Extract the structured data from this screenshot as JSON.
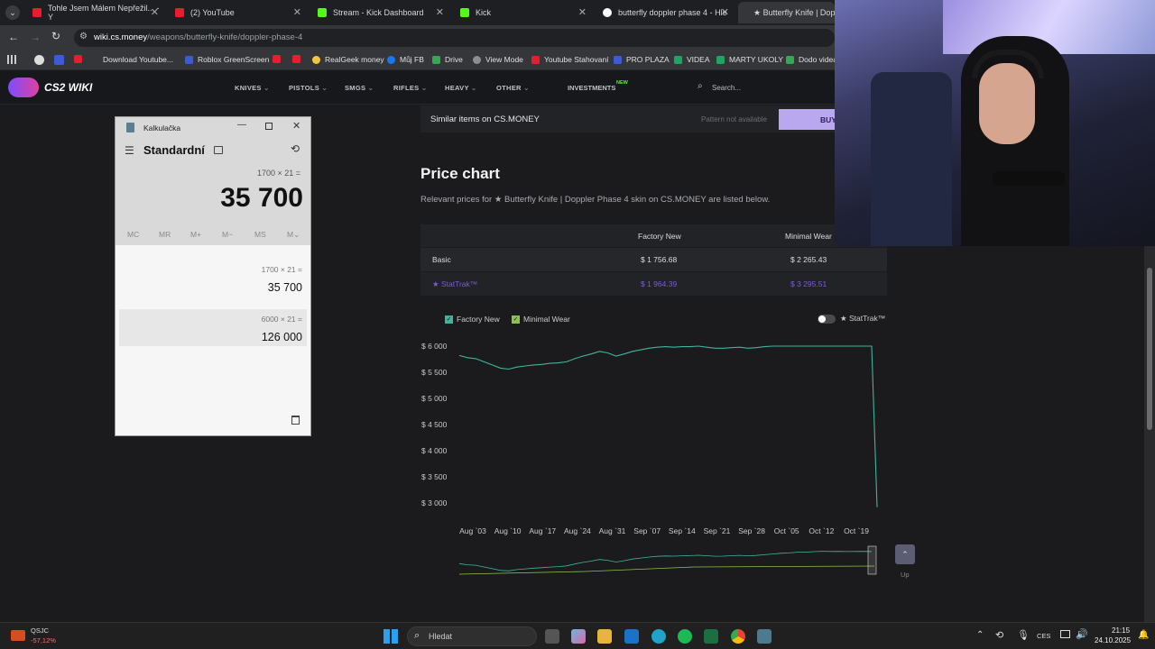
{
  "browser": {
    "tabs": [
      {
        "title": "Tohle Jsem Málem Nepřežil... - Y",
        "color": "#e5202e"
      },
      {
        "title": "(2) YouTube",
        "color": "#e5202e"
      },
      {
        "title": "Stream - Kick Dashboard",
        "color": "#53fc18"
      },
      {
        "title": "Kick",
        "color": "#53fc18"
      },
      {
        "title": "butterfly doppler phase 4 - Hle",
        "color": "#ffffff"
      },
      {
        "title": "★ Butterfly Knife | Dopp",
        "color": "#ffffff"
      }
    ],
    "url_domain": "wiki.cs.money",
    "url_path": "/weapons/butterfly-knife/doppler-phase-4",
    "bookmarks": [
      {
        "label": "",
        "color": "#e5202e"
      },
      {
        "label": "Download Youtube...",
        "color": "#2c2c2c"
      },
      {
        "label": "Roblox GreenScreen",
        "color": "#3b5bdb"
      },
      {
        "label": "",
        "color": "#e5202e"
      },
      {
        "label": "",
        "color": "#e5202e"
      },
      {
        "label": "RealGeek money",
        "color": "#f5c542"
      },
      {
        "label": "Můj FB",
        "color": "#1877f2"
      },
      {
        "label": "Drive",
        "color": "#34a853"
      },
      {
        "label": "View Mode",
        "color": "#8e8e8e"
      },
      {
        "label": "Youtube Stahovaní",
        "color": "#e5202e"
      },
      {
        "label": "PRO PLAZA",
        "color": "#3b5bdb"
      },
      {
        "label": "VIDEA",
        "color": "#1fa463"
      },
      {
        "label": "MARTY UKOLY",
        "color": "#1fa463"
      },
      {
        "label": "Dodo videa",
        "color": "#34a853"
      }
    ]
  },
  "site": {
    "logo": "CS2 WIKI",
    "nav": [
      "KNIVES",
      "PISTOLS",
      "SMGS",
      "RIFLES",
      "HEAVY",
      "OTHER"
    ],
    "investments": "INVESTMENTS",
    "new_badge": "NEW",
    "search_placeholder": "Search..."
  },
  "similar": {
    "title": "Similar items on CS.MONEY",
    "pattern": "Pattern not available",
    "buy": "BUY"
  },
  "price": {
    "heading": "Price chart",
    "subtitle": "Relevant prices for ★ Butterfly Knife | Doppler Phase 4 skin on CS.MONEY are listed below.",
    "col_fn": "Factory New",
    "col_mw": "Minimal Wear",
    "rows": [
      {
        "label": "Basic",
        "fn": "$ 1 756.68",
        "mw": "$ 2 265.43"
      },
      {
        "label": "★ StatTrak™",
        "fn": "$ 1 964.39",
        "mw": "$ 3 295.51"
      }
    ],
    "legend_fn": "Factory New",
    "legend_mw": "Minimal Wear",
    "stattrak_toggle": "★ StatTrak™",
    "up_label": "Up"
  },
  "chart_data": {
    "type": "line",
    "y_ticks": [
      "$ 6 000",
      "$ 5 500",
      "$ 5 000",
      "$ 4 500",
      "$ 4 000",
      "$ 3 500",
      "$ 3 000"
    ],
    "x_ticks": [
      "Aug `03",
      "Aug `10",
      "Aug `17",
      "Aug `24",
      "Aug `31",
      "Sep `07",
      "Sep `14",
      "Sep `21",
      "Sep `28",
      "Oct `05",
      "Oct `12",
      "Oct `19"
    ],
    "ylim": [
      2900,
      6000
    ],
    "series": [
      {
        "name": "Factory New",
        "color": "#3fb59d",
        "values": [
          5820,
          5780,
          5760,
          5700,
          5640,
          5580,
          5560,
          5600,
          5620,
          5640,
          5650,
          5670,
          5680,
          5700,
          5760,
          5810,
          5850,
          5900,
          5870,
          5810,
          5850,
          5900,
          5930,
          5960,
          5980,
          5990,
          5980,
          5990,
          5990,
          6000,
          5980,
          5960,
          5960,
          5970,
          5980,
          5960,
          5970,
          5990,
          6010,
          6030,
          6040,
          6060,
          6060,
          6070,
          6080,
          6070,
          6070,
          6060,
          6060,
          6060,
          6050,
          2920
        ]
      }
    ]
  },
  "calculator": {
    "title": "Kalkulačka",
    "mode": "Standardní",
    "expression": "1700 × 21 =",
    "display": "35 700",
    "memory": [
      "MC",
      "MR",
      "M+",
      "M−",
      "MS",
      "M⌄"
    ],
    "history": [
      {
        "expr": "1700 × 21 =",
        "result": "35 700"
      },
      {
        "expr": "6000 × 21 =",
        "result": "126 000"
      }
    ]
  },
  "taskbar": {
    "weather_name": "QSJC",
    "weather_change": "-57,12%",
    "search": "Hledat",
    "lang": "CES",
    "time": "21:15",
    "date": "24.10.2025"
  }
}
